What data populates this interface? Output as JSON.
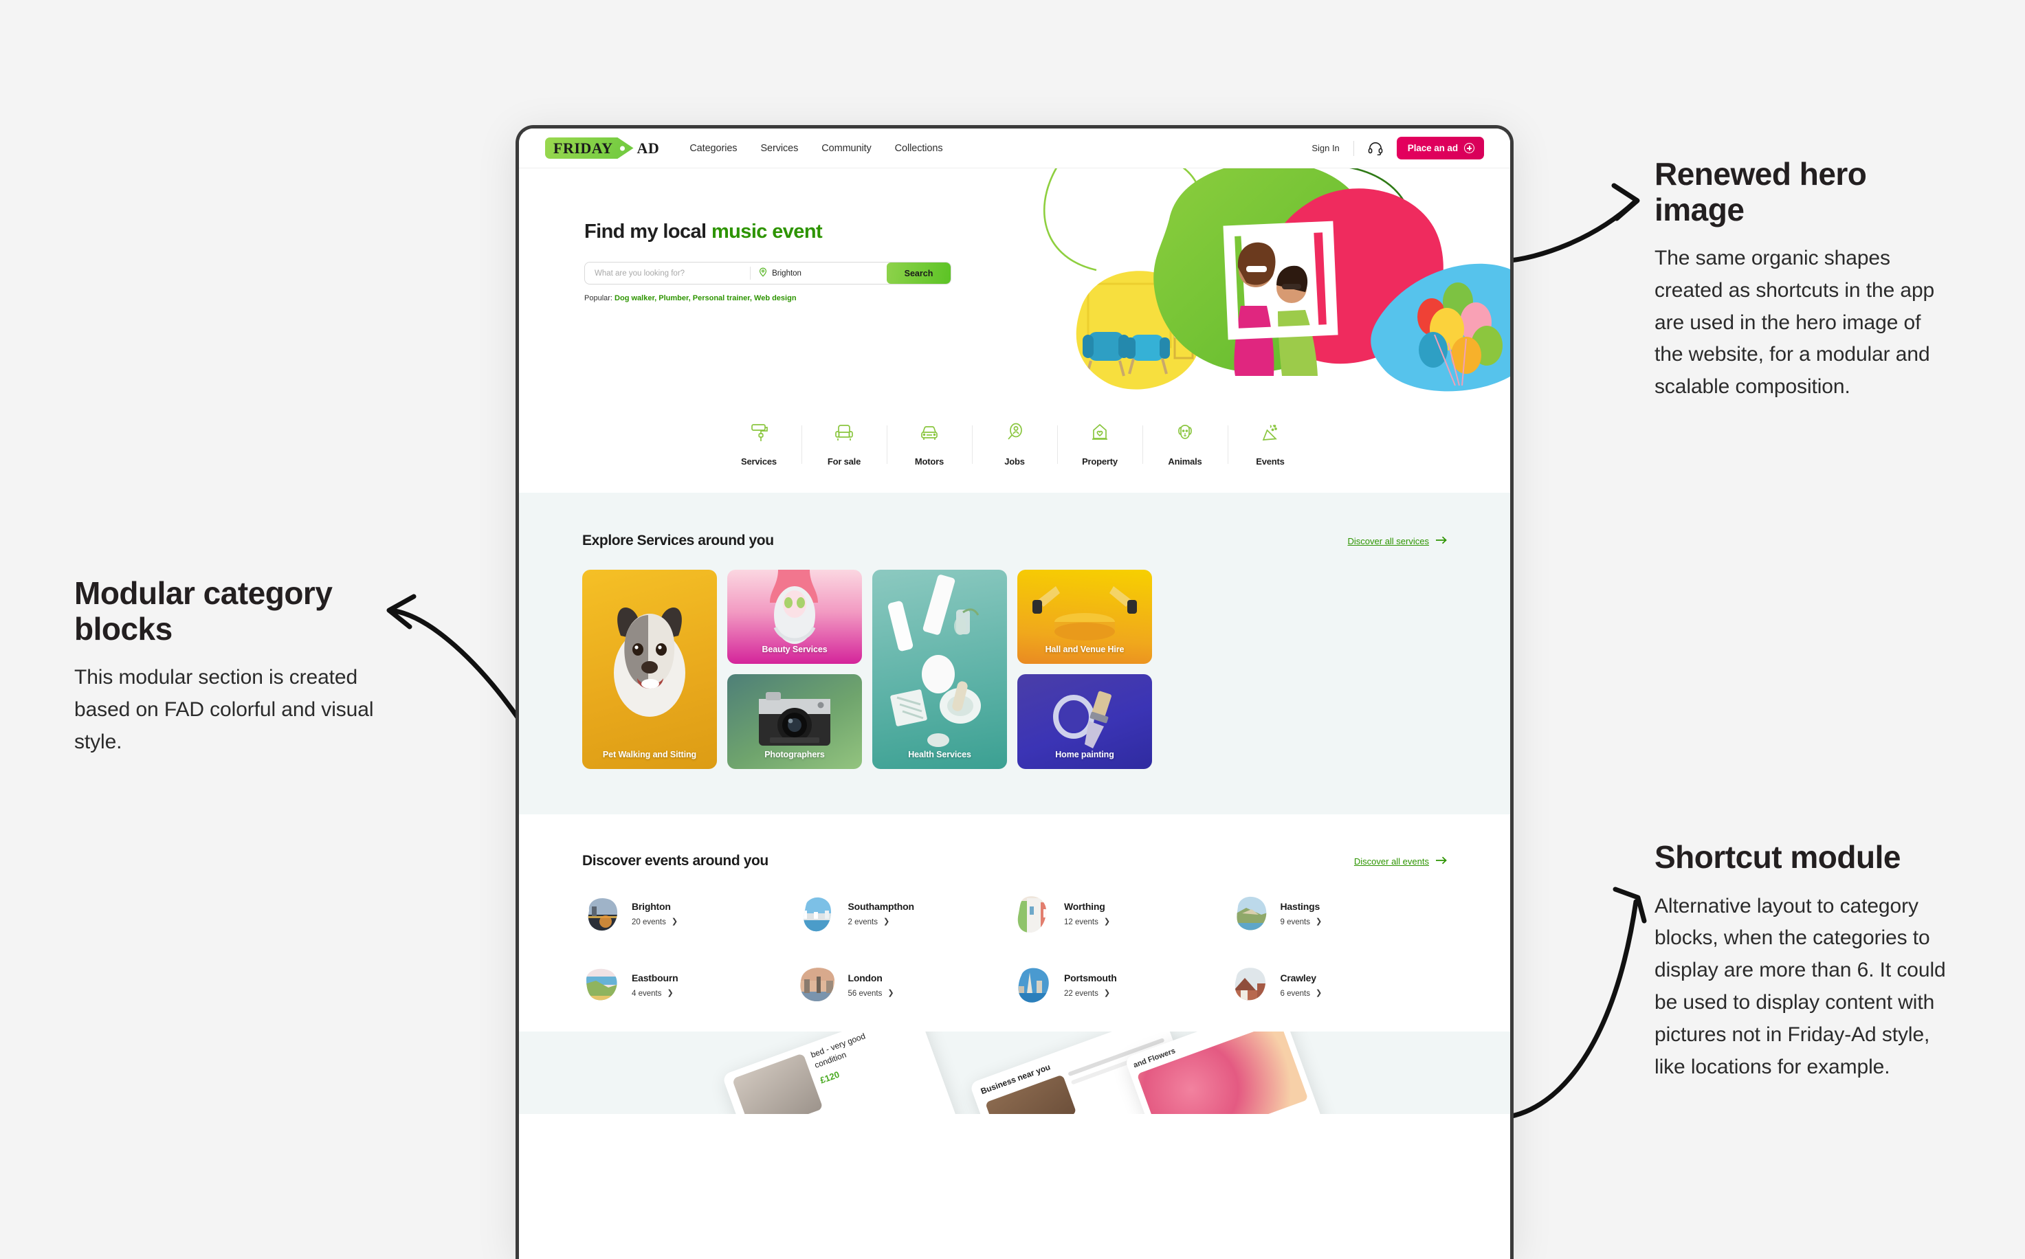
{
  "annotations": [
    {
      "id": "renewed-hero-image",
      "title": "Renewed hero image",
      "body": "The same organic shapes created as shortcuts in the app are used in the hero image of the website, for a modular and scalable composition."
    },
    {
      "id": "modular-category-blocks",
      "title": "Modular category blocks",
      "body": "This modular section is created based on FAD colorful and visual style."
    },
    {
      "id": "shortcut-module",
      "title": "Shortcut module",
      "body": "Alternative layout to category blocks, when the categories to display are more than 6. It could be used to display content with pictures not in Friday-Ad style, like locations for example."
    }
  ],
  "site": {
    "logo": {
      "brand": "FRIDAY",
      "suffix": "AD"
    },
    "nav": [
      "Categories",
      "Services",
      "Community",
      "Collections"
    ],
    "sign_in": "Sign In",
    "support_icon": "headset-icon",
    "place_ad": "Place an ad"
  },
  "hero": {
    "title_prefix": "Find my local ",
    "title_highlight": "music event",
    "search_placeholder": "What are you looking for?",
    "location_value": "Brighton",
    "location_icon": "map-pin-icon",
    "search_button": "Search",
    "popular_label": "Popular:",
    "popular_terms": "Dog walker, Plumber, Personal trainer, Web design"
  },
  "categories": [
    {
      "label": "Services",
      "icon": "paint-roller-icon"
    },
    {
      "label": "For sale",
      "icon": "armchair-icon"
    },
    {
      "label": "Motors",
      "icon": "car-icon"
    },
    {
      "label": "Jobs",
      "icon": "job-search-icon"
    },
    {
      "label": "Property",
      "icon": "house-heart-icon"
    },
    {
      "label": "Animals",
      "icon": "dog-icon"
    },
    {
      "label": "Events",
      "icon": "party-popper-icon"
    }
  ],
  "services_section": {
    "title": "Explore Services around you",
    "link": "Discover all services",
    "cards": [
      {
        "label": "Pet Walking and Sitting",
        "accent": "#e8a81c"
      },
      {
        "label": "Beauty Services",
        "accent": "#d4249a"
      },
      {
        "label": "Photographers",
        "accent": "#6fa46d"
      },
      {
        "label": "Health Services",
        "accent": "#3ba092"
      },
      {
        "label": "Hall and Venue Hire",
        "accent": "#f0a81c"
      },
      {
        "label": "Home painting",
        "accent": "#3b34b5"
      }
    ]
  },
  "events_section": {
    "title": "Discover events around you",
    "link": "Discover all events",
    "items": [
      {
        "name": "Brighton",
        "count": "20 events"
      },
      {
        "name": "Southampthon",
        "count": "2 events"
      },
      {
        "name": "Worthing",
        "count": "12 events"
      },
      {
        "name": "Hastings",
        "count": "9 events"
      },
      {
        "name": "Eastbourn",
        "count": "4 events"
      },
      {
        "name": "London",
        "count": "56 events"
      },
      {
        "name": "Portsmouth",
        "count": "22 events"
      },
      {
        "name": "Crawley",
        "count": "6 events"
      }
    ]
  },
  "mockups": {
    "card_a_title": "bed - very good condition",
    "card_a_price": "£120",
    "card_b_title": "Business near you",
    "card_b_caption": "and Flowers"
  },
  "colors": {
    "brand_green": "#2d9400",
    "accent_green": "#8ed24b",
    "magenta": "#e4005d",
    "section_bg": "#f1f6f6",
    "page_bg": "#f4f4f4"
  }
}
